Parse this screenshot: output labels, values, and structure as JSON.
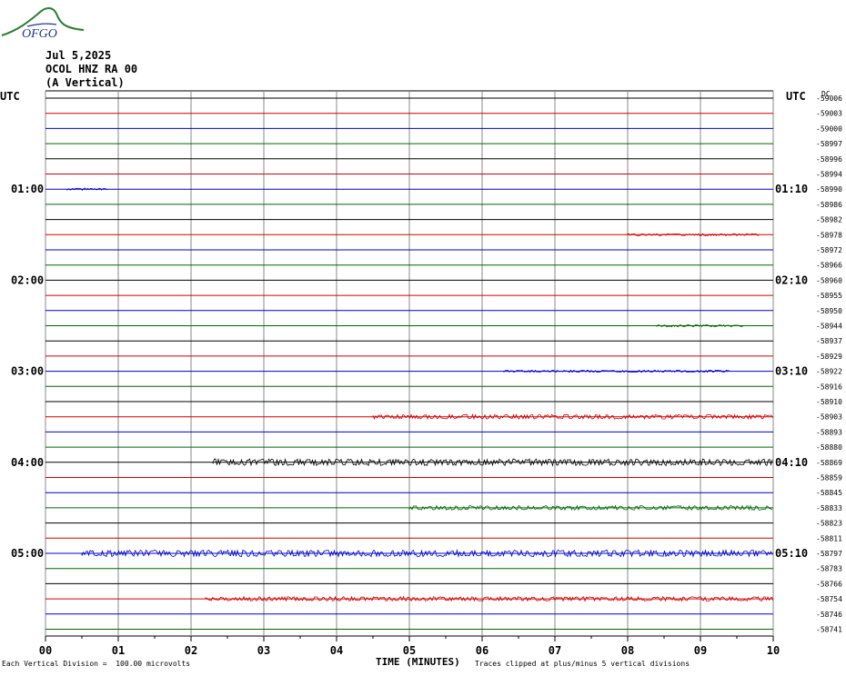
{
  "logo_text": "OFGO",
  "header": {
    "date": "Jul 5,2025",
    "station": "OCOL HNZ RA 00",
    "component": "(A Vertical)"
  },
  "utc_left_label": "UTC",
  "utc_right_label": "UTC",
  "dc_label": "DC",
  "footer": {
    "division": "Each Vertical Division =  100.00 microvolts",
    "clip": "Traces clipped at plus/minus 5 vertical divisions"
  },
  "colors": {
    "black": "#000000",
    "red": "#cc0000",
    "blue": "#0000cc",
    "green": "#006600",
    "grid": "#888888"
  },
  "chart_data": {
    "type": "line",
    "title": "Jul 5,2025 OCOL HNZ RA 00 (A Vertical)",
    "xlabel": "TIME (MINUTES)",
    "ylabel": "UTC",
    "xlim": [
      0,
      10
    ],
    "x_ticks": [
      "00",
      "01",
      "02",
      "03",
      "04",
      "05",
      "06",
      "07",
      "08",
      "09",
      "10"
    ],
    "minutes_per_trace": 10,
    "left_time_labels": [
      {
        "row": 6,
        "label": "01:00"
      },
      {
        "row": 12,
        "label": "02:00"
      },
      {
        "row": 18,
        "label": "03:00"
      },
      {
        "row": 24,
        "label": "04:00"
      },
      {
        "row": 30,
        "label": "05:00"
      }
    ],
    "right_time_labels": [
      {
        "row": 6,
        "label": "01:10"
      },
      {
        "row": 12,
        "label": "02:10"
      },
      {
        "row": 18,
        "label": "03:10"
      },
      {
        "row": 24,
        "label": "04:10"
      },
      {
        "row": 30,
        "label": "05:10"
      }
    ],
    "trace_color_cycle": [
      "black",
      "red",
      "blue",
      "green"
    ],
    "dc_offsets": [
      "-59006",
      "-59003",
      "-59000",
      "-58997",
      "-58996",
      "-58994",
      "-58990",
      "-58986",
      "-58982",
      "-58978",
      "-58972",
      "-58966",
      "-58960",
      "-58955",
      "-58950",
      "-58944",
      "-58937",
      "-58929",
      "-58922",
      "-58916",
      "-58910",
      "-58903",
      "-58893",
      "-58880",
      "-58869",
      "-58859",
      "-58845",
      "-58833",
      "-58823",
      "-58811",
      "-58797",
      "-58783",
      "-58766",
      "-58754",
      "-58746",
      "-58741"
    ],
    "activity": [
      {
        "row": 6,
        "start_min": 0.3,
        "end_min": 0.85,
        "level": 1
      },
      {
        "row": 9,
        "start_min": 8.0,
        "end_min": 9.8,
        "level": 1
      },
      {
        "row": 15,
        "start_min": 8.4,
        "end_min": 9.6,
        "level": 1
      },
      {
        "row": 18,
        "start_min": 6.3,
        "end_min": 9.4,
        "level": 1
      },
      {
        "row": 21,
        "start_min": 4.5,
        "end_min": 10.0,
        "level": 2
      },
      {
        "row": 24,
        "start_min": 2.3,
        "end_min": 10.0,
        "level": 3
      },
      {
        "row": 27,
        "start_min": 5.0,
        "end_min": 10.0,
        "level": 2
      },
      {
        "row": 30,
        "start_min": 0.5,
        "end_min": 10.0,
        "level": 3
      },
      {
        "row": 33,
        "start_min": 2.2,
        "end_min": 10.0,
        "level": 2
      }
    ]
  }
}
